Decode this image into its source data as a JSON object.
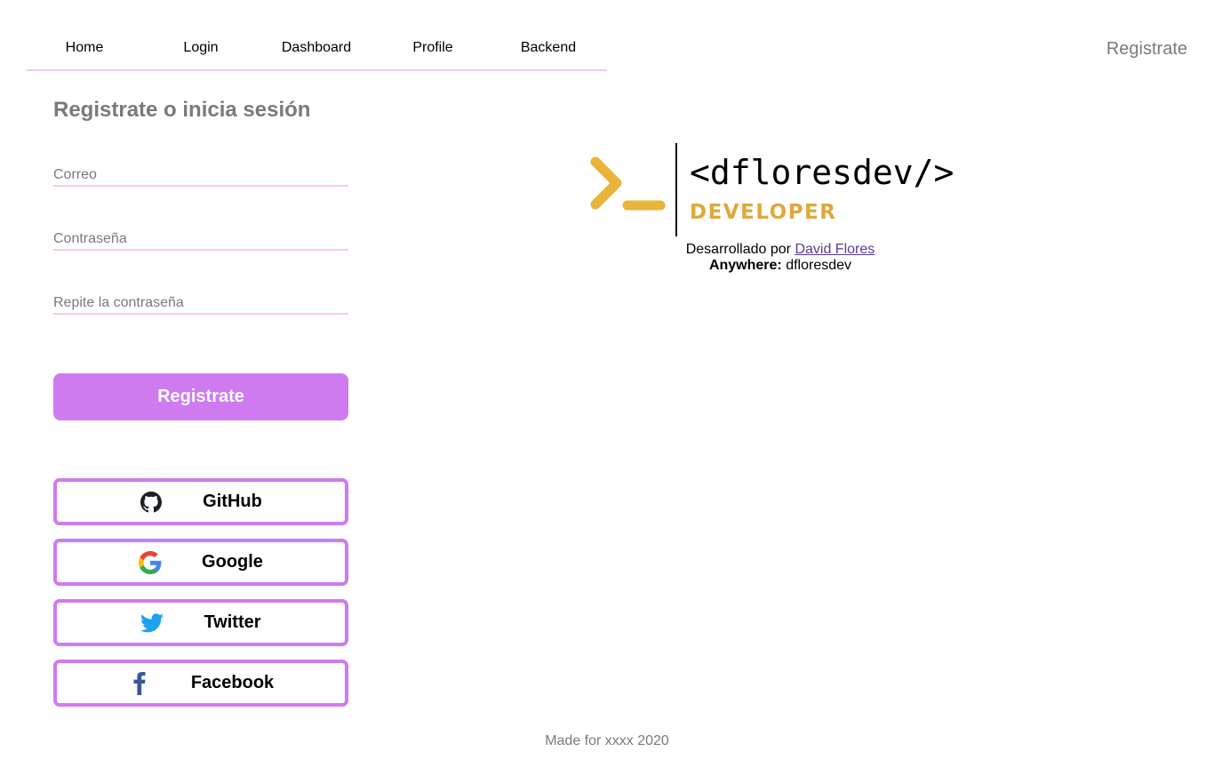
{
  "nav": {
    "items": [
      {
        "label": "Home"
      },
      {
        "label": "Login"
      },
      {
        "label": "Dashboard"
      },
      {
        "label": "Profile"
      },
      {
        "label": "Backend"
      }
    ],
    "right_label": "Registrate"
  },
  "form": {
    "title": "Registrate o inicia sesión",
    "email": {
      "placeholder": "Correo",
      "value": ""
    },
    "password": {
      "placeholder": "Contraseña",
      "value": ""
    },
    "password_repeat": {
      "placeholder": "Repite la contraseña",
      "value": ""
    },
    "submit_label": "Registrate"
  },
  "social": [
    {
      "label": "GitHub",
      "icon": "github-icon"
    },
    {
      "label": "Google",
      "icon": "google-icon"
    },
    {
      "label": "Twitter",
      "icon": "twitter-icon"
    },
    {
      "label": "Facebook",
      "icon": "facebook-icon"
    }
  ],
  "brand": {
    "name": "<dfloresdev/>",
    "tagline": "DEVELOPER",
    "prompt_color": "#e8b43a",
    "tagline_color": "#e0a83a"
  },
  "credits": {
    "prefix": "Desarrollado por",
    "author": "David Flores",
    "anywhere_label": "Anywhere:",
    "anywhere_value": "dfloresdev"
  },
  "footer": {
    "text": "Made for xxxx 2020"
  },
  "colors": {
    "accent": "#cf7bf0",
    "underline": "#f2c6ec",
    "muted_text": "#7a7a7a"
  }
}
